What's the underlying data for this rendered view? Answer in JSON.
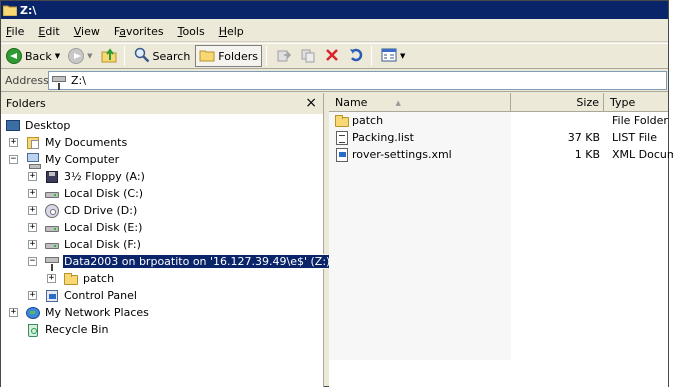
{
  "window": {
    "title": "Z:\\"
  },
  "menu": [
    {
      "first": "F",
      "rest": "ile"
    },
    {
      "first": "E",
      "rest": "dit"
    },
    {
      "first": "V",
      "rest": "iew"
    },
    {
      "first": "",
      "rest": "Favorites",
      "ul_index": 1
    },
    {
      "first": "T",
      "rest": "ools"
    },
    {
      "first": "H",
      "rest": "elp"
    }
  ],
  "menu_labels": [
    "File",
    "Edit",
    "View",
    "Favorites",
    "Tools",
    "Help"
  ],
  "toolbar": {
    "back_label": "Back",
    "search_label": "Search",
    "folders_label": "Folders"
  },
  "address": {
    "label": "Address",
    "value": "Z:\\"
  },
  "folders_pane": {
    "title": "Folders",
    "close": "×",
    "tree": [
      {
        "label": "Desktop",
        "icon": "desktop-icon",
        "expander": ""
      },
      {
        "label": "My Documents",
        "icon": "my-documents-icon",
        "expander": "+"
      },
      {
        "label": "My Computer",
        "icon": "my-computer-icon",
        "expander": "−"
      },
      {
        "label": "3½ Floppy (A:)",
        "icon": "floppy-drive-icon",
        "expander": "+"
      },
      {
        "label": "Local Disk (C:)",
        "icon": "hard-drive-icon",
        "expander": "+"
      },
      {
        "label": "CD Drive (D:)",
        "icon": "cd-drive-icon",
        "expander": "+"
      },
      {
        "label": "Local Disk (E:)",
        "icon": "hard-drive-icon",
        "expander": "+"
      },
      {
        "label": "Local Disk (F:)",
        "icon": "hard-drive-icon",
        "expander": "+"
      },
      {
        "label": "Data2003 on brpoatito on '16.127.39.49\\e$' (Z:)",
        "icon": "network-drive-icon",
        "expander": "−",
        "selected": true
      },
      {
        "label": "patch",
        "icon": "folder-icon",
        "expander": "+"
      },
      {
        "label": "Control Panel",
        "icon": "control-panel-icon",
        "expander": "+"
      },
      {
        "label": "My Network Places",
        "icon": "network-places-icon",
        "expander": "+"
      },
      {
        "label": "Recycle Bin",
        "icon": "recycle-bin-icon",
        "expander": ""
      }
    ]
  },
  "file_list": {
    "columns": {
      "name": "Name",
      "size": "Size",
      "type": "Type"
    },
    "rows": [
      {
        "name": "patch",
        "size": "",
        "type": "File Folder",
        "icon": "folder-icon"
      },
      {
        "name": "Packing.list",
        "size": "37 KB",
        "type": "LIST File",
        "icon": "list-file-icon"
      },
      {
        "name": "rover-settings.xml",
        "size": "1 KB",
        "type": "XML Docume",
        "icon": "xml-file-icon"
      }
    ]
  },
  "colors": {
    "titlebar": "#0a246a",
    "chrome": "#ece9d8",
    "selection": "#0a246a"
  }
}
